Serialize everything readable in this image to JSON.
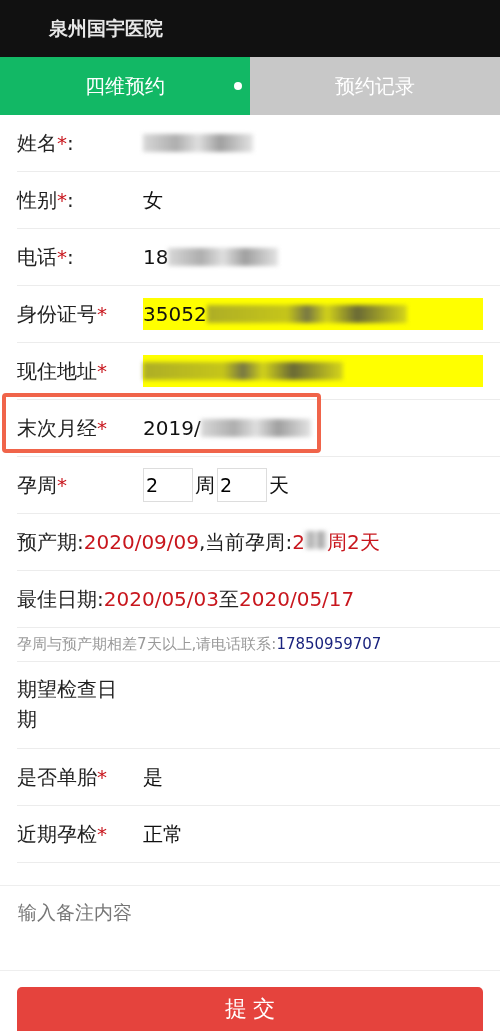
{
  "header": {
    "title": "泉州国宇医院"
  },
  "tabs": [
    {
      "label": "四维预约",
      "selected": true
    },
    {
      "label": "预约记录",
      "selected": false
    }
  ],
  "rows": [
    {
      "kind": "text",
      "label": "姓名",
      "mark": "*",
      "colon": ":",
      "redacted": true
    },
    {
      "kind": "text",
      "label": "性别",
      "mark": "*",
      "colon": ":",
      "value": "女"
    },
    {
      "kind": "text",
      "label": "电话",
      "mark": "*",
      "colon": ":",
      "value": "18",
      "redacted": true
    },
    {
      "kind": "filled",
      "label": "身份证号",
      "mark": "*",
      "value": "35052",
      "redacted": true
    },
    {
      "kind": "filled",
      "label": "现住地址",
      "mark": "*",
      "redacted": true
    },
    {
      "kind": "text",
      "label": "末次月经",
      "mark": "*",
      "value": "2019/",
      "redacted": true,
      "highlighted": true
    },
    {
      "kind": "weeks",
      "label": "孕周",
      "mark": "*",
      "weeks": "2",
      "weeks_unit": "周",
      "days": "2",
      "days_unit": "天"
    },
    {
      "kind": "info",
      "segments": [
        {
          "text": "预产期:",
          "color": "#222222"
        },
        {
          "text": "2020/09/09",
          "color": "#c8161d"
        },
        {
          "text": ",当前孕周:",
          "color": "#222222"
        },
        {
          "text": "2",
          "color": "#c8161d",
          "redacted": true
        },
        {
          "text": "周2天",
          "color": "#c8161d"
        }
      ]
    },
    {
      "kind": "info",
      "segments": [
        {
          "text": "最佳日期:",
          "color": "#222222"
        },
        {
          "text": "2020/05/03",
          "color": "#c8161d"
        },
        {
          "text": "至",
          "color": "#222222"
        },
        {
          "text": "2020/05/17",
          "color": "#c8161d"
        }
      ]
    },
    {
      "kind": "note",
      "text": "孕周与预产期相差7天以上,请电话联系:",
      "phone": "17850959707"
    },
    {
      "kind": "multiline",
      "label": "期望检查日期"
    },
    {
      "kind": "text",
      "label": "是否单胎",
      "mark": "*",
      "value": "是"
    },
    {
      "kind": "text",
      "label": "近期孕检",
      "mark": "*",
      "value": "正常"
    }
  ],
  "remarks": {
    "placeholder": "输入备注内容"
  },
  "submit": {
    "label": "提 交"
  }
}
